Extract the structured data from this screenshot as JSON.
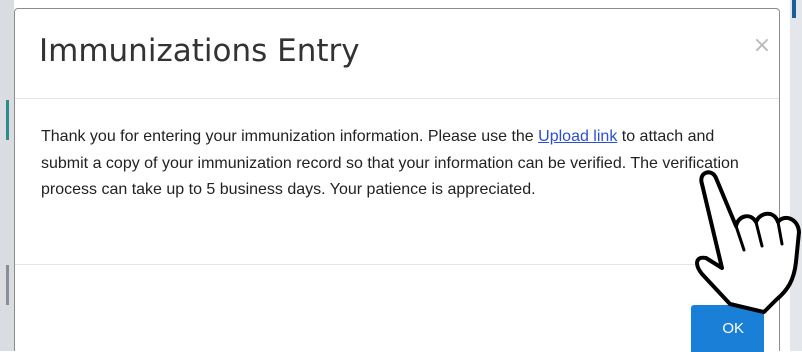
{
  "dialog": {
    "title": "Immunizations Entry",
    "close_glyph": "×",
    "body": {
      "text_before_link": "Thank you for entering your immunization information.  Please use the ",
      "link_text": "Upload link",
      "text_after_link": " to attach and submit a copy of your immunization record so that your information can be verified. The verification process can take up to 5 business days. Your patience is appreciated."
    },
    "ok_label": "OK"
  },
  "overlay": {
    "cursor_icon": "hand-pointer-icon"
  },
  "colors": {
    "link": "#2a4ed8",
    "primary_button": "#1a7fd6",
    "title_text": "#333333",
    "body_text": "#222222"
  }
}
